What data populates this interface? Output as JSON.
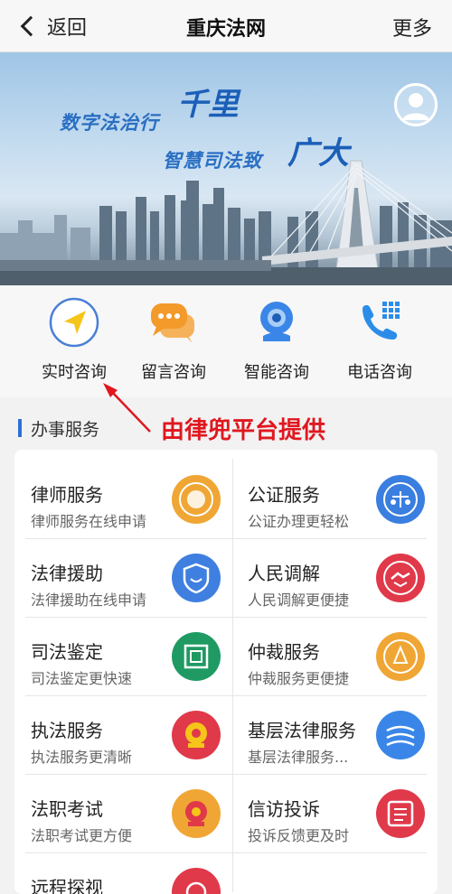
{
  "navbar": {
    "back_label": "返回",
    "title": "重庆法网",
    "more_label": "更多"
  },
  "banner": {
    "slogan_line1": "数字法治行",
    "slogan_big1": "千里",
    "slogan_line2": "智慧司法致",
    "slogan_big2": "广大"
  },
  "quick_actions": [
    {
      "label": "实时咨询",
      "icon": "navigation-arrow-icon",
      "color": "#f5c519"
    },
    {
      "label": "留言咨询",
      "icon": "chat-bubbles-icon",
      "color": "#f4a23c"
    },
    {
      "label": "智能咨询",
      "icon": "webcam-robot-icon",
      "color": "#3a86e8"
    },
    {
      "label": "电话咨询",
      "icon": "phone-keypad-icon",
      "color": "#2b8de8"
    }
  ],
  "section": {
    "title": "办事服务"
  },
  "annotation": "由律兜平台提供",
  "services": [
    {
      "title": "律师服务",
      "subtitle": "律师服务在线申请",
      "icon": "lawyer-badge-icon",
      "color": "#f0a634"
    },
    {
      "title": "公证服务",
      "subtitle": "公证办理更轻松",
      "icon": "notary-scale-icon",
      "color": "#3a7ee0"
    },
    {
      "title": "法律援助",
      "subtitle": "法律援助在线申请",
      "icon": "legal-aid-shield-icon",
      "color": "#3f7fe0"
    },
    {
      "title": "人民调解",
      "subtitle": "人民调解更便捷",
      "icon": "mediation-handshake-icon",
      "color": "#e0394a"
    },
    {
      "title": "司法鉴定",
      "subtitle": "司法鉴定更快速",
      "icon": "appraisal-seal-icon",
      "color": "#1f9a63"
    },
    {
      "title": "仲裁服务",
      "subtitle": "仲裁服务更便捷",
      "icon": "arbitration-emblem-icon",
      "color": "#f0a634"
    },
    {
      "title": "执法服务",
      "subtitle": "执法服务更清晰",
      "icon": "national-emblem-icon",
      "color": "#e0394a"
    },
    {
      "title": "基层法律服务",
      "subtitle": "基层法律服务...",
      "icon": "community-service-icon",
      "color": "#3a86e8"
    },
    {
      "title": "法职考试",
      "subtitle": "法职考试更方便",
      "icon": "exam-emblem-icon",
      "color": "#f0a634"
    },
    {
      "title": "信访投诉",
      "subtitle": "投诉反馈更及时",
      "icon": "petition-letter-icon",
      "color": "#e0394a"
    },
    {
      "title": "远程探视",
      "subtitle": "",
      "icon": "remote-visit-icon",
      "color": "#e0394a"
    }
  ]
}
